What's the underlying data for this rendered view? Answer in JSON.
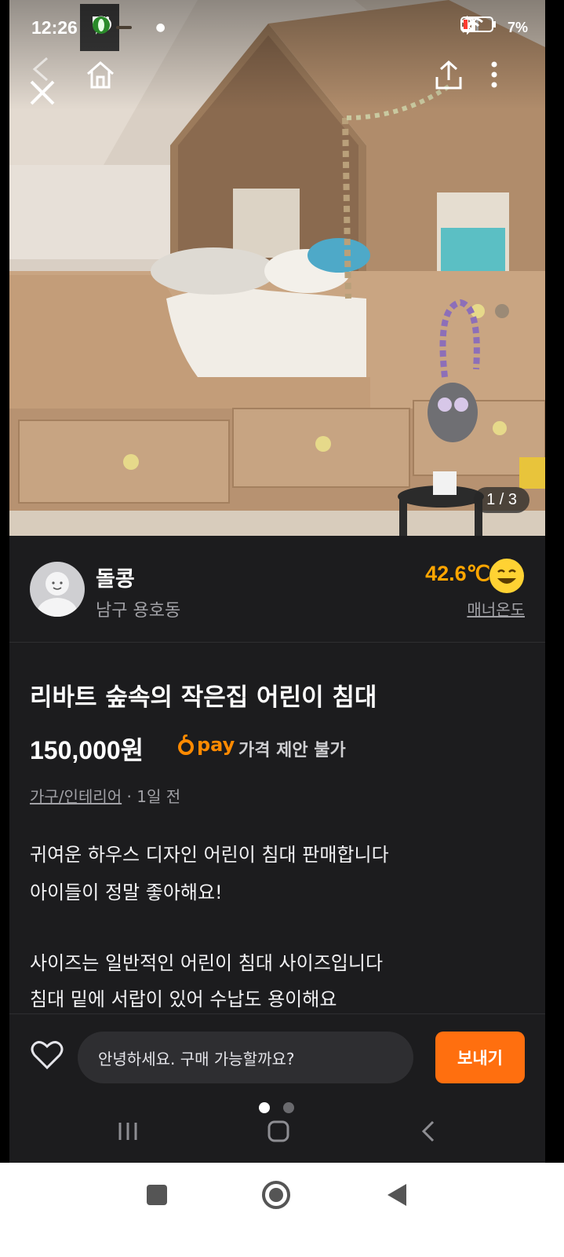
{
  "status_bar": {
    "time": "12:26",
    "left_badge": "7",
    "battery": "7%",
    "icons": [
      "talk-icon",
      "notification-icon",
      "camera-icon",
      "chat-icon",
      "bluetooth-icon",
      "mute-icon",
      "signal-icon",
      "wifi-icon",
      "battery-icon"
    ]
  },
  "image": {
    "counter": "1 / 3",
    "alt_subject": "house-frame-kids-bed-photo"
  },
  "seller": {
    "name": "돌콩",
    "location": "남구 용호동",
    "temperature": "42.6℃",
    "manner_label": "매너온도"
  },
  "product": {
    "title": "리바트 숲속의 작은집 어린이 침대",
    "price_number": "150,000",
    "price_unit": "원",
    "pay_label": "pay",
    "negotiation": "가격 제안 불가",
    "category": "가구/인테리어",
    "time_ago": "· 1일 전",
    "description": [
      "귀여운 하우스 디자인 어린이 침대 판매합니다",
      "아이들이 정말 좋아해요!",
      "",
      "사이즈는 일반적인 어린이 침대 사이즈입니다",
      "침대 밑에 서랍이 있어 수납도 용이해요"
    ]
  },
  "bottom_bar": {
    "message_value": "안녕하세요. 구매 가능할까요?",
    "send_label": "보내기"
  },
  "colors": {
    "accent": "#ff6f0f",
    "temperature": "#ffa500",
    "background": "#1c1c1e"
  }
}
